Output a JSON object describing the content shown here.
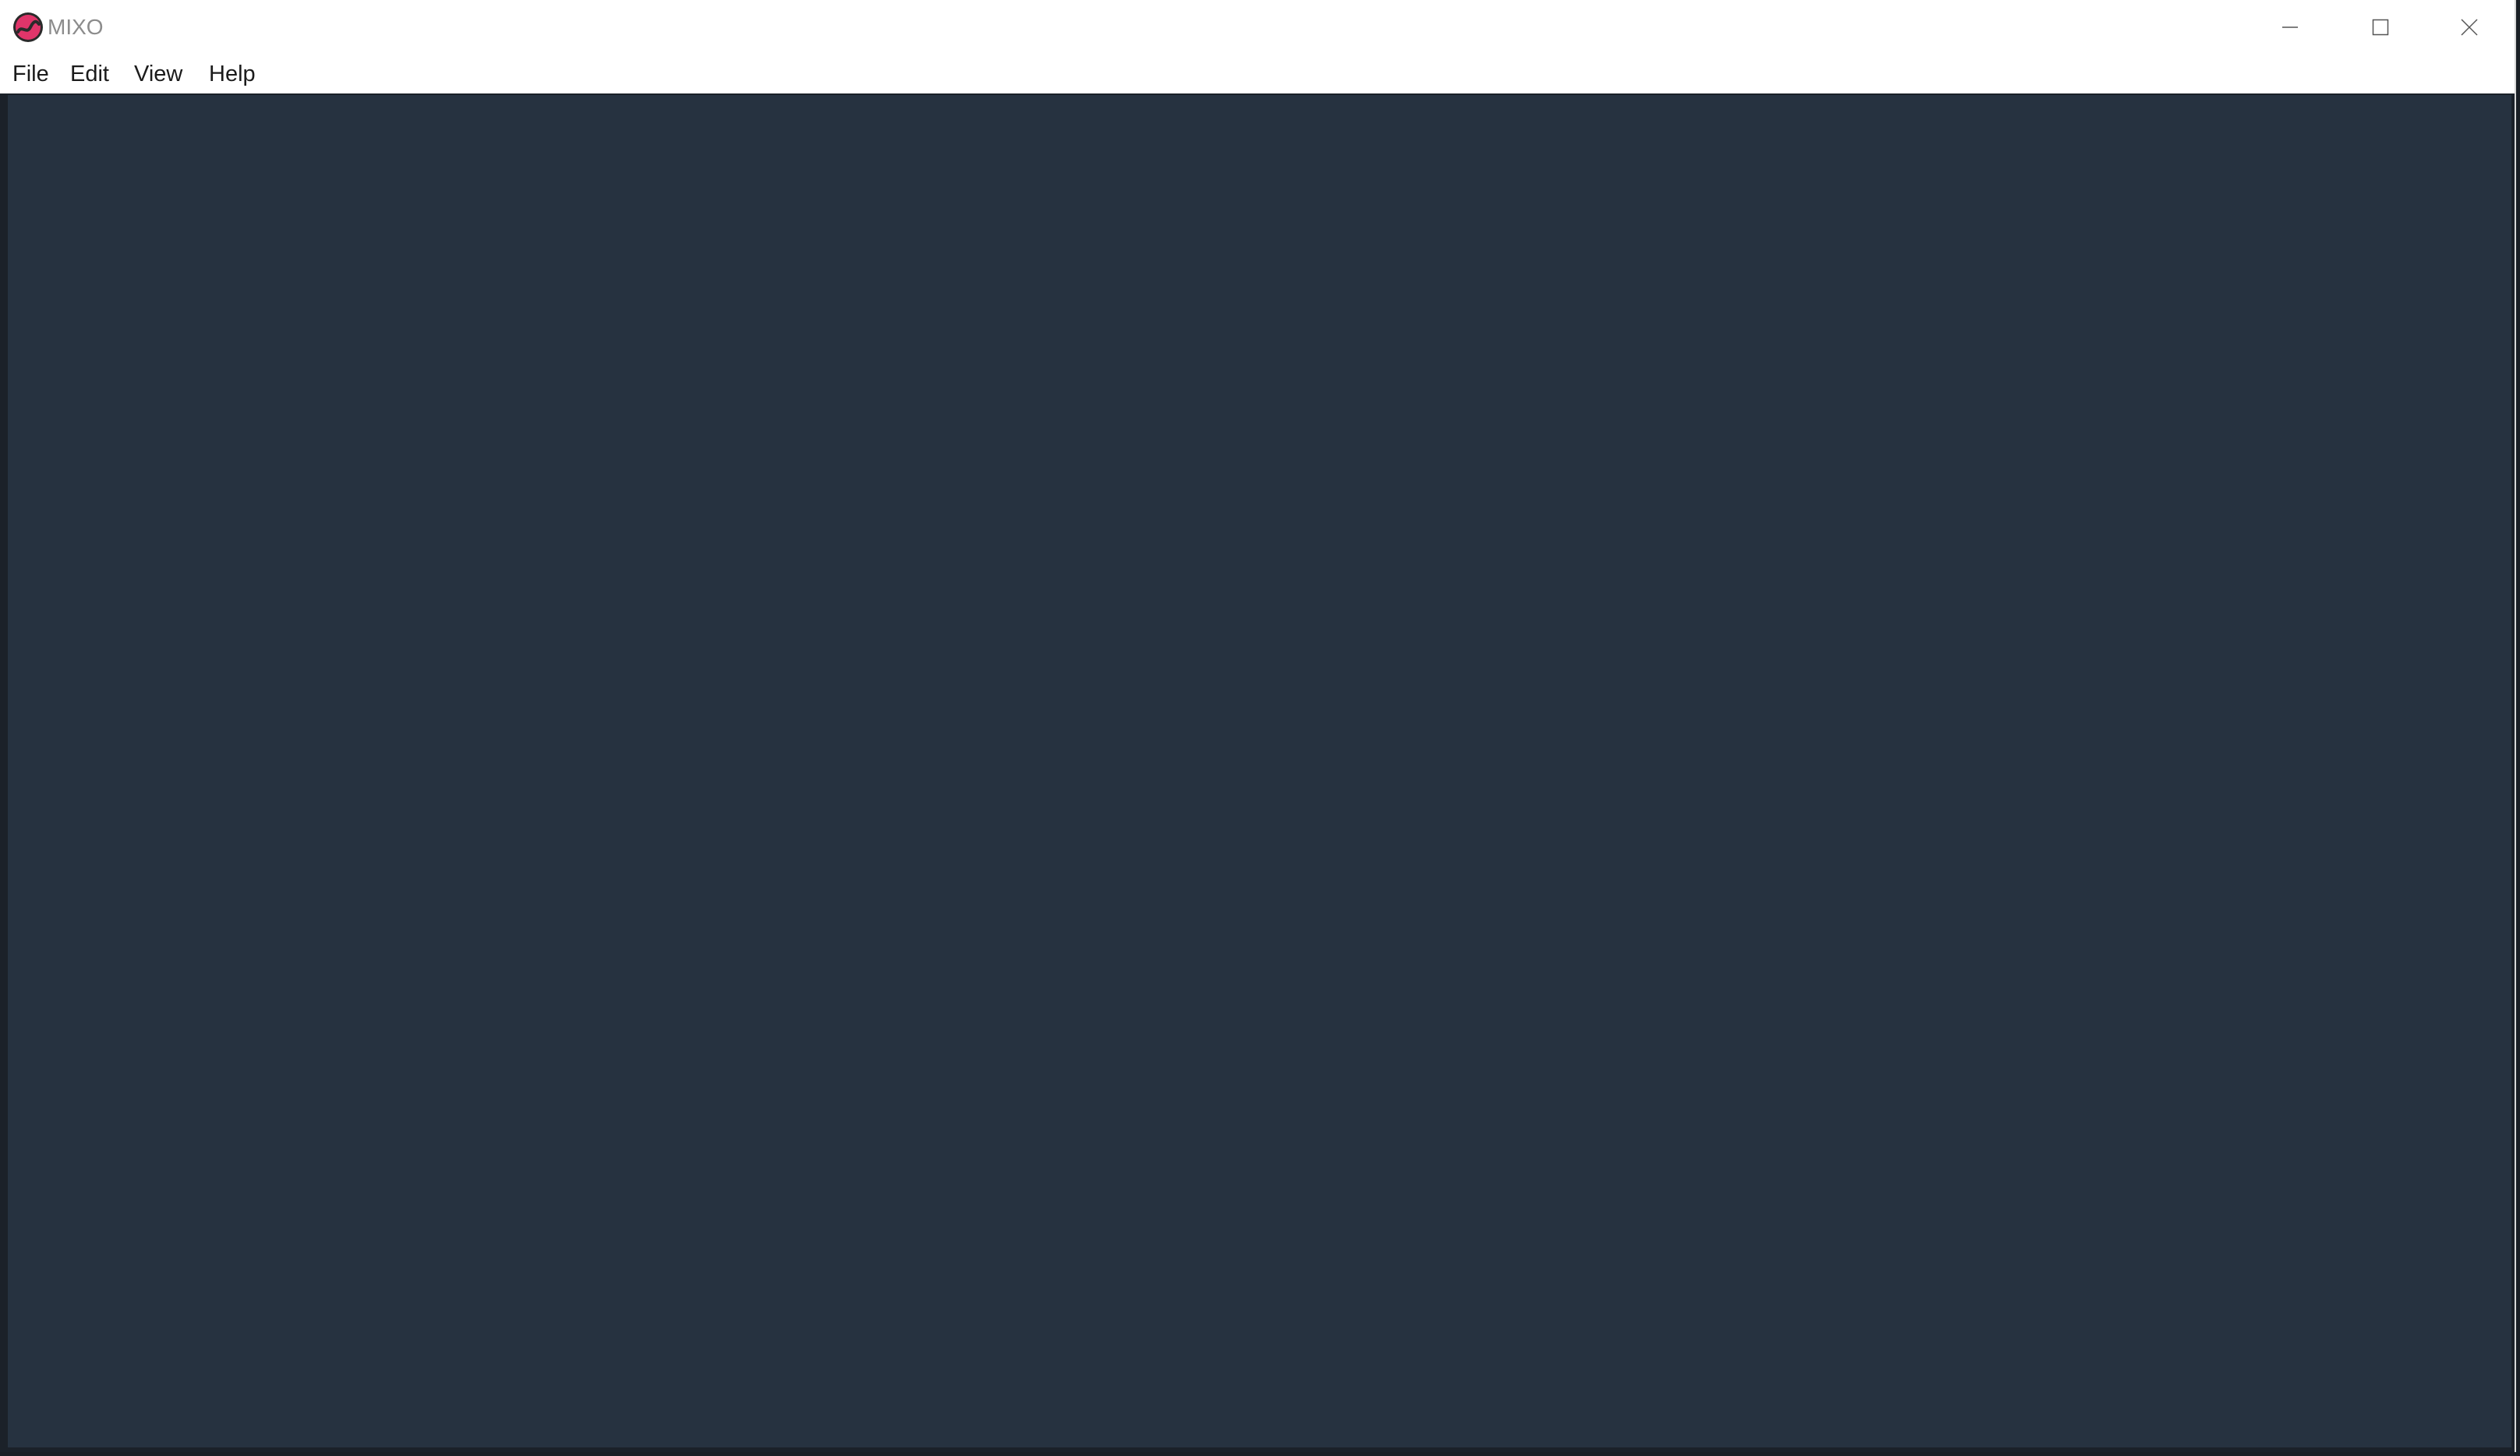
{
  "window": {
    "title": "MIXO",
    "icon": "mixo-logo-icon",
    "controls": [
      "minimize-icon",
      "maximize-icon",
      "close-icon"
    ]
  },
  "menu": {
    "items": [
      "File",
      "Edit",
      "View",
      "Help"
    ]
  },
  "colors": {
    "accent": "#e0356a",
    "workspace": "#263240",
    "frame": "#1b2129"
  }
}
